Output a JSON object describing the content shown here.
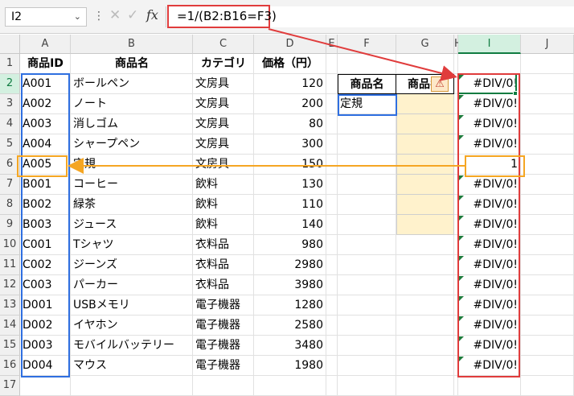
{
  "name_box": "I2",
  "formula": "=1/(B2:B16=F3)",
  "columns": [
    "A",
    "B",
    "C",
    "D",
    "E",
    "F",
    "G",
    "H",
    "I",
    "J"
  ],
  "selected_column": "I",
  "rows": [
    "1",
    "2",
    "3",
    "4",
    "5",
    "6",
    "7",
    "8",
    "9",
    "10",
    "11",
    "12",
    "13",
    "14",
    "15",
    "16",
    "17"
  ],
  "headers": {
    "A": "商品ID",
    "B": "商品名",
    "C": "カテゴリ",
    "D": "価格（円）"
  },
  "table": [
    [
      "A001",
      "ボールペン",
      "文房具",
      "120"
    ],
    [
      "A002",
      "ノート",
      "文房具",
      "200"
    ],
    [
      "A003",
      "消しゴム",
      "文房具",
      "80"
    ],
    [
      "A004",
      "シャープペン",
      "文房具",
      "300"
    ],
    [
      "A005",
      "定規",
      "文房具",
      "150"
    ],
    [
      "B001",
      "コーヒー",
      "飲料",
      "130"
    ],
    [
      "B002",
      "緑茶",
      "飲料",
      "110"
    ],
    [
      "B003",
      "ジュース",
      "飲料",
      "140"
    ],
    [
      "C001",
      "Tシャツ",
      "衣料品",
      "980"
    ],
    [
      "C002",
      "ジーンズ",
      "衣料品",
      "2980"
    ],
    [
      "C003",
      "パーカー",
      "衣料品",
      "3980"
    ],
    [
      "D001",
      "USBメモリ",
      "電子機器",
      "1280"
    ],
    [
      "D002",
      "イヤホン",
      "電子機器",
      "2580"
    ],
    [
      "D003",
      "モバイルバッテリー",
      "電子機器",
      "3480"
    ],
    [
      "D004",
      "マウス",
      "電子機器",
      "1980"
    ]
  ],
  "lookup": {
    "f_header": "商品名",
    "g_header": "商品名",
    "f_value": "定規"
  },
  "results": [
    "#DIV/0!",
    "#DIV/0!",
    "#DIV/0!",
    "#DIV/0!",
    "1",
    "#DIV/0!",
    "#DIV/0!",
    "#DIV/0!",
    "#DIV/0!",
    "#DIV/0!",
    "#DIV/0!",
    "#DIV/0!",
    "#DIV/0!",
    "#DIV/0!",
    "#DIV/0!"
  ],
  "colors": {
    "red": "#e03c3c",
    "blue": "#2f6fe0",
    "orange": "#f5a623",
    "yellow_fill": "#fff2cc",
    "excel_green": "#107c41"
  },
  "icons": {
    "warning": "warning-icon",
    "fx": "fx-icon",
    "cancel": "cancel-icon",
    "enter": "enter-icon",
    "chevron": "chevron-down-icon"
  }
}
